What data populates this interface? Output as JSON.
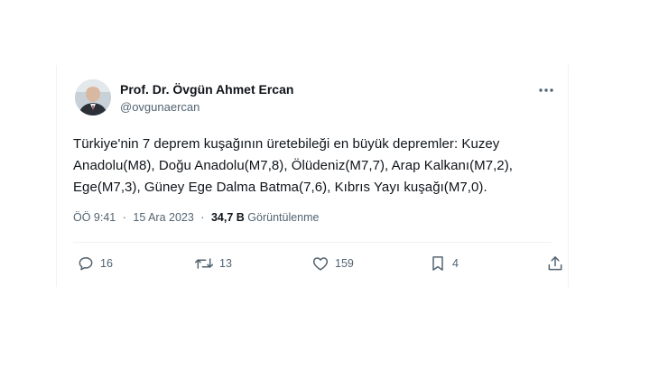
{
  "tweet": {
    "author_name": "Prof. Dr. Övgün Ahmet Ercan",
    "handle": "@ovgunaercan",
    "text": "Türkiye'nin 7 deprem kuşağının üretebileği en büyük depremler: Kuzey Anadolu(M8), Doğu Anadolu(M7,8), Ölüdeniz(M7,7), Arap Kalkanı(M7,2), Ege(M7,3), Güney Ege Dalma Batma(7,6), Kıbrıs Yayı kuşağı(M7,0).",
    "time": "ÖÖ 9:41",
    "separator": "·",
    "date": "15 Ara 2023",
    "views_count": "34,7 B",
    "views_label": "Görüntülenme"
  },
  "actions": {
    "reply_count": "16",
    "retweet_count": "13",
    "like_count": "159",
    "bookmark_count": "4"
  },
  "icons": {
    "more": "more-horizontal-icon",
    "reply": "reply-icon",
    "retweet": "retweet-icon",
    "like": "heart-icon",
    "bookmark": "bookmark-icon",
    "share": "share-icon"
  },
  "colors": {
    "text": "#0f1419",
    "secondary": "#536471",
    "border": "#eff3f4"
  }
}
